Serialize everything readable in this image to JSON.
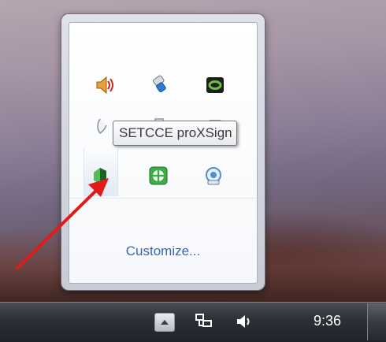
{
  "tray": {
    "tooltip": "SETCCE proXSign",
    "customize_label": "Customize...",
    "icons": [
      "speaker-muted-icon",
      "usb-device-icon",
      "nvidia-icon",
      "network-icon",
      "folder-icon",
      "setcce-proxsign-icon",
      "green-app-icon",
      "support-assistant-icon"
    ]
  },
  "taskbar": {
    "clock": "9:36"
  },
  "colors": {
    "link": "#3a67b0",
    "arrow": "#e01b1b"
  }
}
